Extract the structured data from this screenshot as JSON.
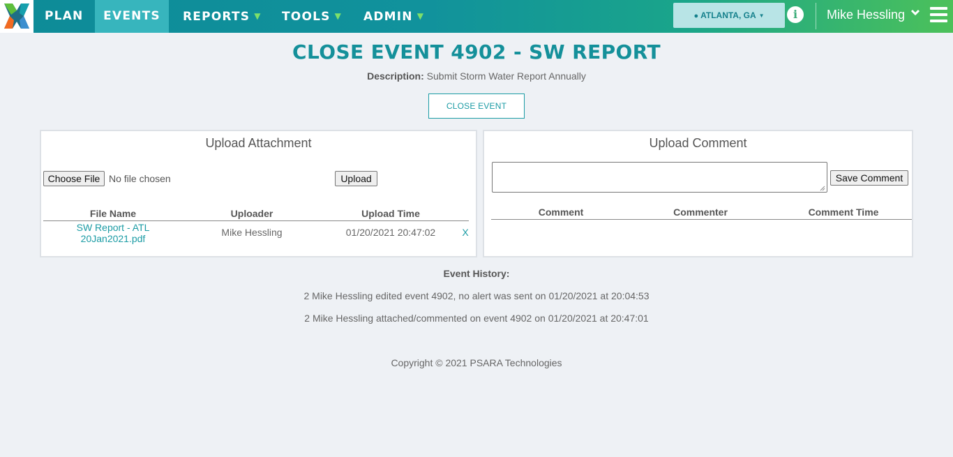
{
  "nav": {
    "items": [
      {
        "label": "PLAN"
      },
      {
        "label": "EVENTS"
      },
      {
        "label": "REPORTS"
      },
      {
        "label": "TOOLS"
      },
      {
        "label": "ADMIN"
      }
    ],
    "location": "ATLANTA, GA",
    "user_name": "Mike Hessling",
    "colors": {
      "brand_start": "#0d8b98",
      "brand_end": "#4cc15a",
      "active_tab": "#37b5bd",
      "accent": "#1a9ba4"
    }
  },
  "page": {
    "title": "CLOSE EVENT 4902 - SW REPORT",
    "description_label": "Description:",
    "description_text": "Submit Storm Water Report Annually",
    "close_button": "CLOSE EVENT"
  },
  "attachments": {
    "title": "Upload Attachment",
    "choose_file_label": "Choose File",
    "no_file_text": "No file chosen",
    "upload_label": "Upload",
    "columns": [
      "File Name",
      "Uploader",
      "Upload Time"
    ],
    "rows": [
      {
        "file_name_line1": "SW Report - ATL",
        "file_name_line2": "20Jan2021.pdf",
        "uploader": "Mike Hessling",
        "upload_time": "01/20/2021 20:47:02",
        "delete": "X"
      }
    ]
  },
  "comments": {
    "title": "Upload Comment",
    "input_value": "",
    "save_label": "Save Comment",
    "columns": [
      "Comment",
      "Commenter",
      "Comment Time"
    ]
  },
  "history": {
    "title": "Event History:",
    "entries": [
      "2 Mike Hessling edited event 4902, no alert was sent on 01/20/2021 at 20:04:53",
      "2 Mike Hessling attached/commented on event 4902 on 01/20/2021 at 20:47:01"
    ]
  },
  "footer": {
    "copyright": "Copyright © 2021 PSARA Technologies"
  }
}
